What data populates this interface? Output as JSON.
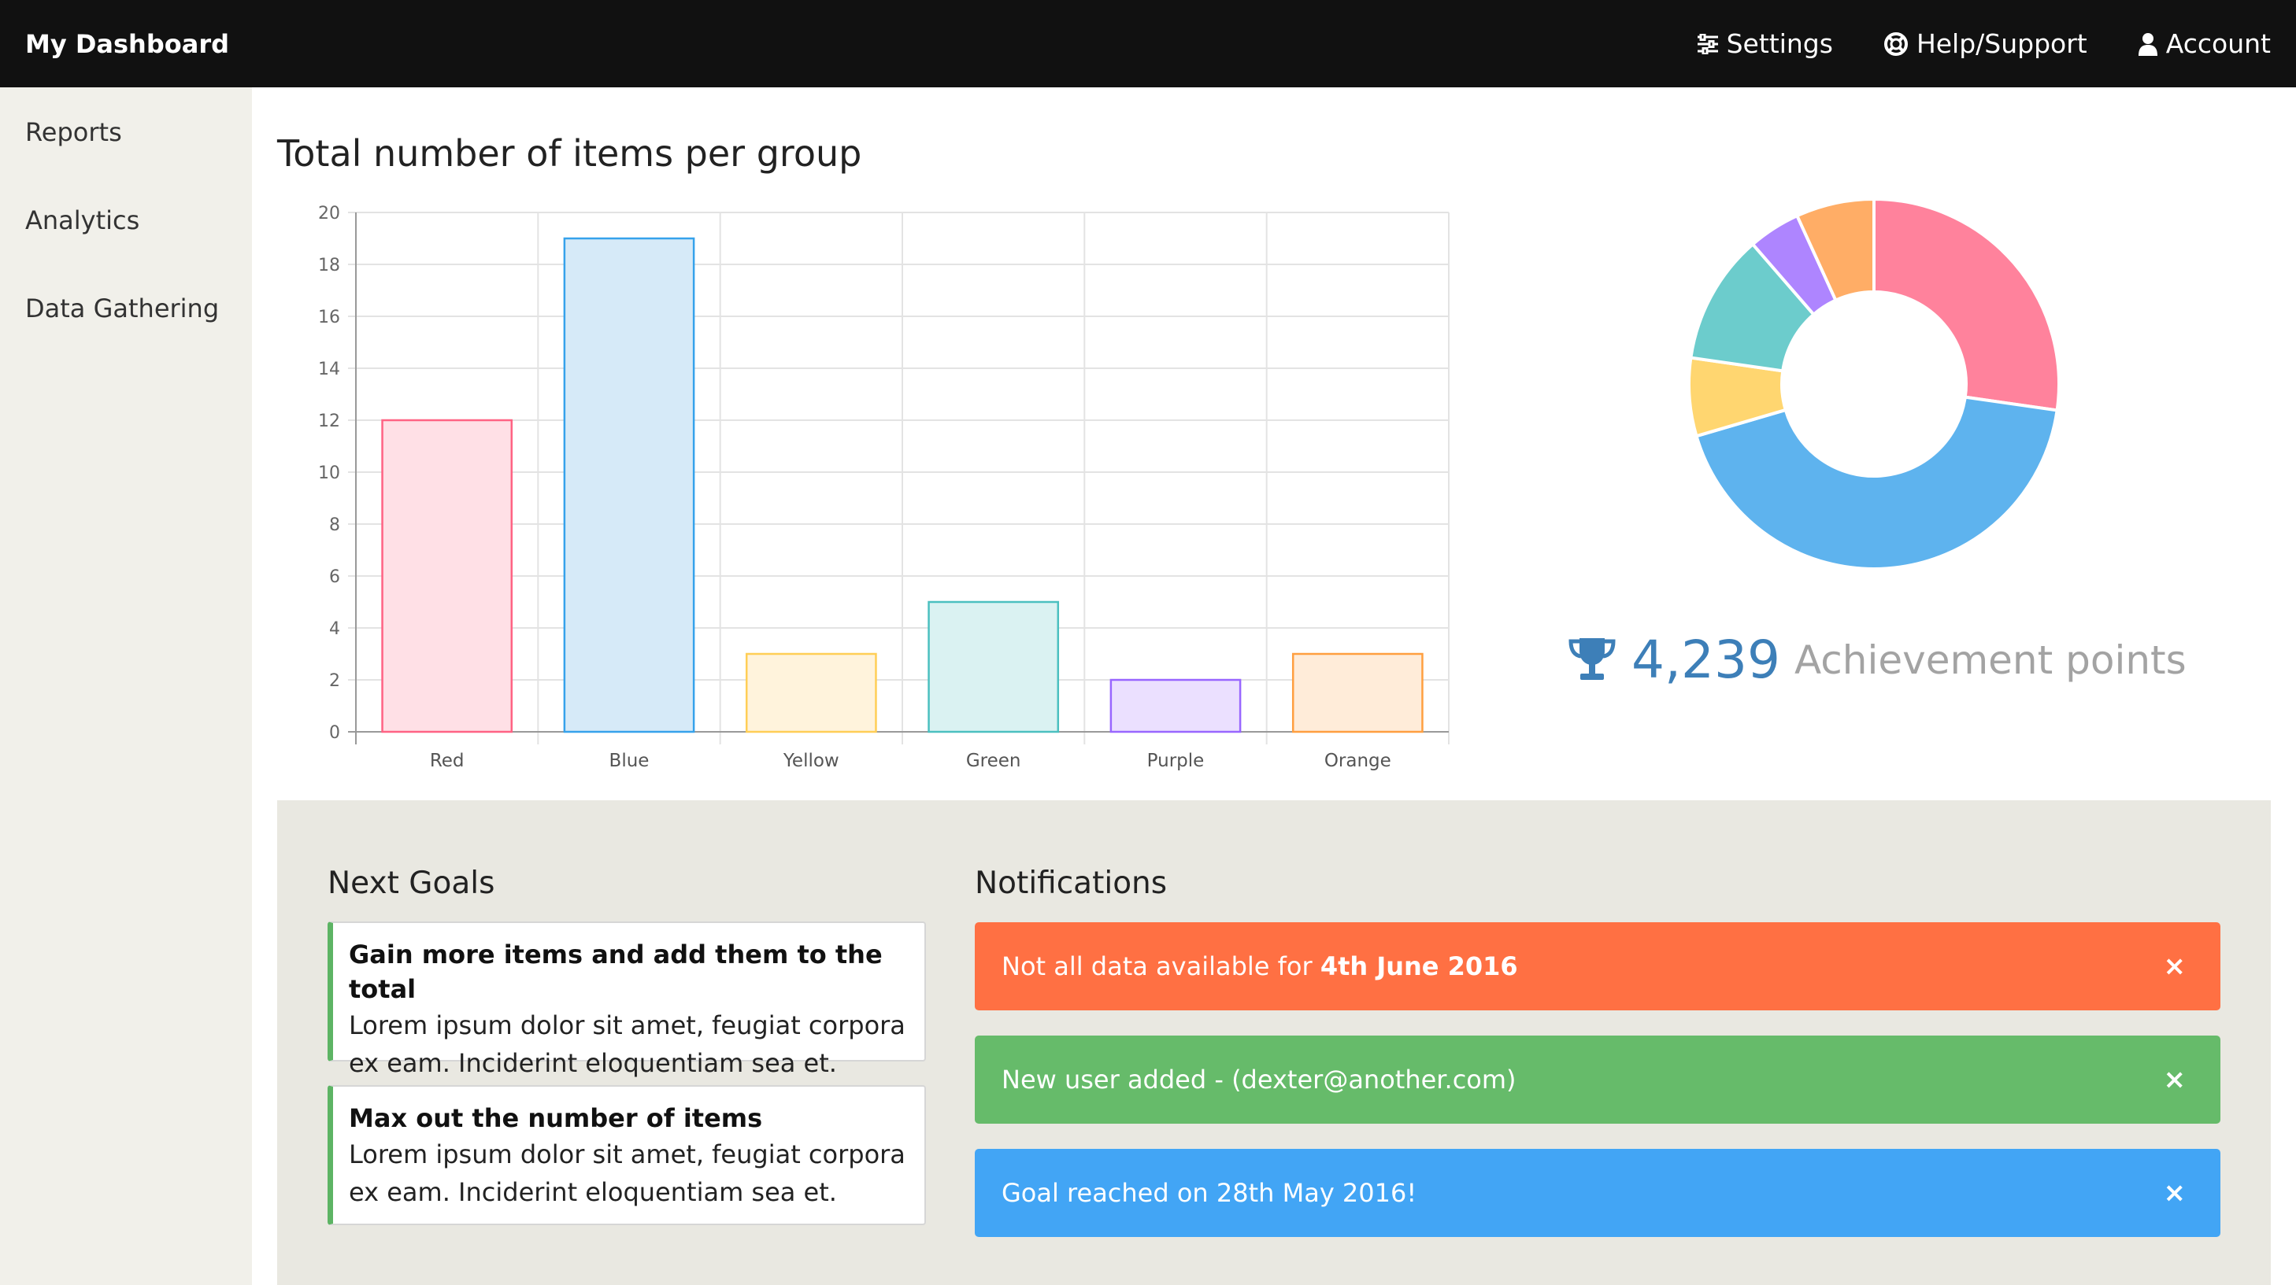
{
  "app": {
    "title": "My Dashboard"
  },
  "topnav": {
    "settings": {
      "label": "Settings",
      "icon": "sliders-icon"
    },
    "help": {
      "label": "Help/Support",
      "icon": "lifebuoy-icon"
    },
    "account": {
      "label": "Account",
      "icon": "user-icon"
    }
  },
  "sidebar": {
    "items": [
      {
        "label": "Reports"
      },
      {
        "label": "Analytics"
      },
      {
        "label": "Data Gathering"
      }
    ]
  },
  "main": {
    "chart_title": "Total number of items per group",
    "achievement": {
      "value": "4,239",
      "label": "Achievement points",
      "icon": "trophy-icon"
    }
  },
  "chart_data": [
    {
      "type": "bar",
      "title": "Total number of items per group",
      "categories": [
        "Red",
        "Blue",
        "Yellow",
        "Green",
        "Purple",
        "Orange"
      ],
      "values": [
        12,
        19,
        3,
        5,
        2,
        3
      ],
      "ylim": [
        0,
        20
      ],
      "yticks": [
        0,
        2,
        4,
        6,
        8,
        10,
        12,
        14,
        16,
        18,
        20
      ],
      "grid": true,
      "fill_colors": [
        "#ffe0e6",
        "#d6eaf8",
        "#fff3dc",
        "#daf2f2",
        "#ebe0ff",
        "#ffecd9"
      ],
      "border_colors": [
        "#ff6384",
        "#36a2eb",
        "#ffce56",
        "#4bc0c0",
        "#9966ff",
        "#ff9f40"
      ]
    },
    {
      "type": "pie",
      "donut": true,
      "categories": [
        "Red",
        "Blue",
        "Yellow",
        "Green",
        "Purple",
        "Orange"
      ],
      "values": [
        12,
        19,
        3,
        5,
        2,
        3
      ],
      "colors": [
        "#ff829c",
        "#5eb3ee",
        "#ffd670",
        "#6ccccc",
        "#ae85ff",
        "#ffad66"
      ]
    }
  ],
  "goals": {
    "title": "Next Goals",
    "items": [
      {
        "title": "Gain more items and add them to the total",
        "text": "Lorem ipsum dolor sit amet, feugiat corpora ex eam. Inciderint eloquentiam sea et."
      },
      {
        "title": "Max out the number of items",
        "text": "Lorem ipsum dolor sit amet, feugiat corpora ex eam. Inciderint eloquentiam sea et."
      }
    ],
    "accent_color": "#5db464"
  },
  "notifications": {
    "title": "Notifications",
    "items": [
      {
        "text": "Not all data available for ",
        "bold": "4th June 2016",
        "color": "#ff7043",
        "close": "×"
      },
      {
        "text": "New user added - (dexter@another.com)",
        "bold": "",
        "color": "#66bb6a",
        "close": "×"
      },
      {
        "text": "Goal reached on 28th May 2016!",
        "bold": "",
        "color": "#42a5f5",
        "close": "×"
      }
    ]
  }
}
